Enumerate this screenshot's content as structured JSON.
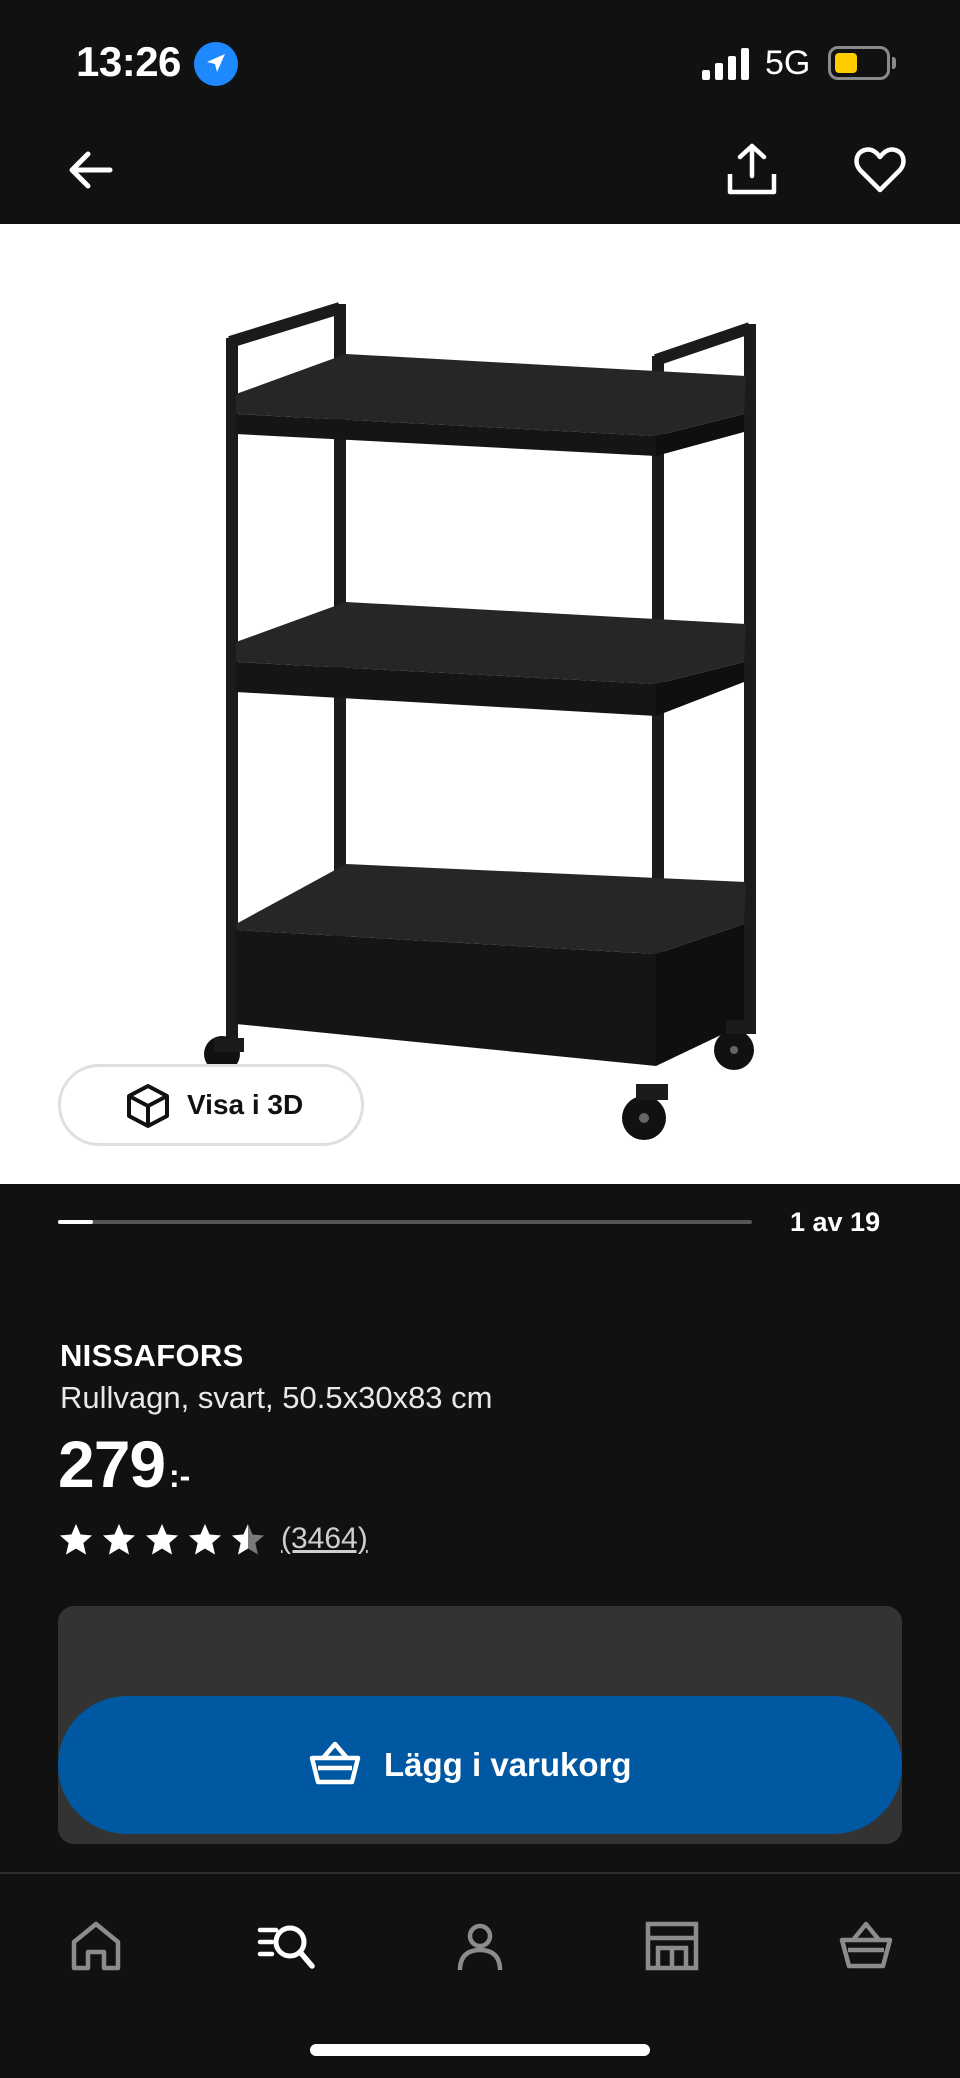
{
  "status": {
    "time": "13:26",
    "network": "5G",
    "battery_color": "#ffcc00"
  },
  "nav": {
    "icons": [
      "back-arrow-icon",
      "share-icon",
      "heart-icon"
    ]
  },
  "gallery": {
    "view_3d_label": "Visa i 3D",
    "current_image": 1,
    "total_images": 19,
    "counter_text": "1 av 19",
    "progress_fraction": 0.05
  },
  "product": {
    "name": "NISSAFORS",
    "description": "Rullvagn, svart, 50.5x30x83 cm",
    "price": "279",
    "price_suffix": ":-",
    "rating_value": 4.5,
    "rating_max": 5,
    "review_count": "(3464)"
  },
  "cart": {
    "button_label": "Lägg i varukorg",
    "button_color": "#0058a3"
  },
  "tabbar": {
    "items": [
      "home-icon",
      "search-icon",
      "profile-icon",
      "store-icon",
      "basket-icon"
    ],
    "active": "search-icon"
  }
}
